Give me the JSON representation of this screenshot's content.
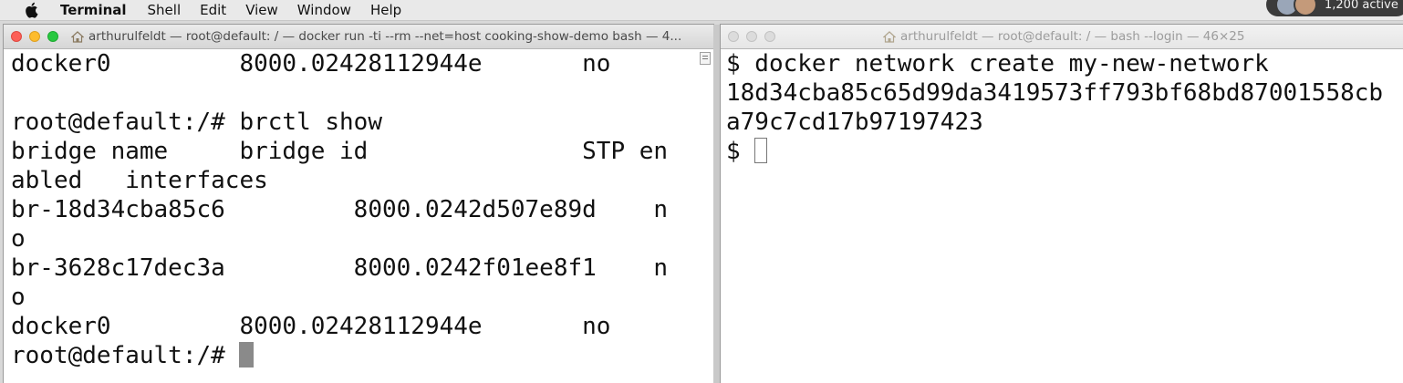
{
  "menubar": {
    "app_name": "Terminal",
    "items": [
      "Shell",
      "Edit",
      "View",
      "Window",
      "Help"
    ],
    "badge_text": "1,200 active"
  },
  "left_window": {
    "title": "arthurulfeldt — root@default: / — docker run -ti --rm --net=host cooking-show-demo bash — 4...",
    "lines": [
      "docker0         8000.02428112944e       no",
      "",
      "root@default:/# brctl show",
      "bridge name     bridge id               STP en",
      "abled   interfaces",
      "br-18d34cba85c6         8000.0242d507e89d    n",
      "o",
      "br-3628c17dec3a         8000.0242f01ee8f1    n",
      "o",
      "docker0         8000.02428112944e       no"
    ],
    "prompt": "root@default:/# "
  },
  "right_window": {
    "title": "arthurulfeldt — root@default: / — bash --login — 46×25",
    "lines": [
      "$ docker network create my-new-network",
      "18d34cba85c65d99da3419573ff793bf68bd87001558cb",
      "a79c7cd17b97197423"
    ],
    "prompt": "$ "
  },
  "colors": {
    "close": "#fc5f57",
    "minimize": "#fdbc2e",
    "zoom": "#28c840"
  }
}
